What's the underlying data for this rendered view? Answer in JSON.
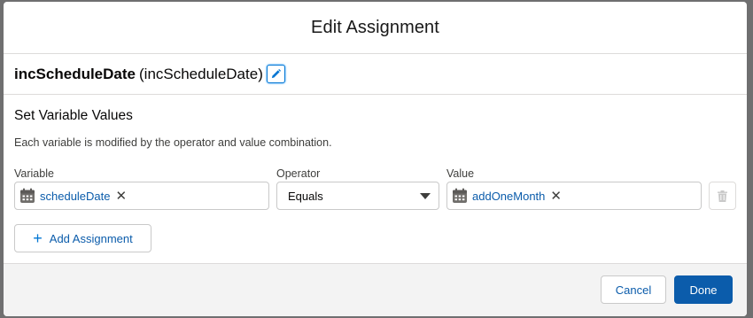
{
  "modal": {
    "title": "Edit Assignment",
    "element_name": "incScheduleDate",
    "element_api": "(incScheduleDate)",
    "edit_icon": "pencil-icon"
  },
  "section": {
    "title": "Set Variable Values",
    "description": "Each variable is modified by the operator and value combination."
  },
  "row": {
    "variable_label": "Variable",
    "variable_value": "scheduleDate",
    "operator_label": "Operator",
    "operator_value": "Equals",
    "value_label": "Value",
    "value_value": "addOneMonth",
    "variable_icon": "calendar-icon",
    "value_icon": "calendar-icon",
    "remove_icon": "close-icon",
    "delete_icon": "trash-icon"
  },
  "add_assignment_label": "Add Assignment",
  "footer": {
    "cancel_label": "Cancel",
    "done_label": "Done"
  },
  "colors": {
    "brand": "#0b5cab",
    "border": "#c9c9c9"
  }
}
